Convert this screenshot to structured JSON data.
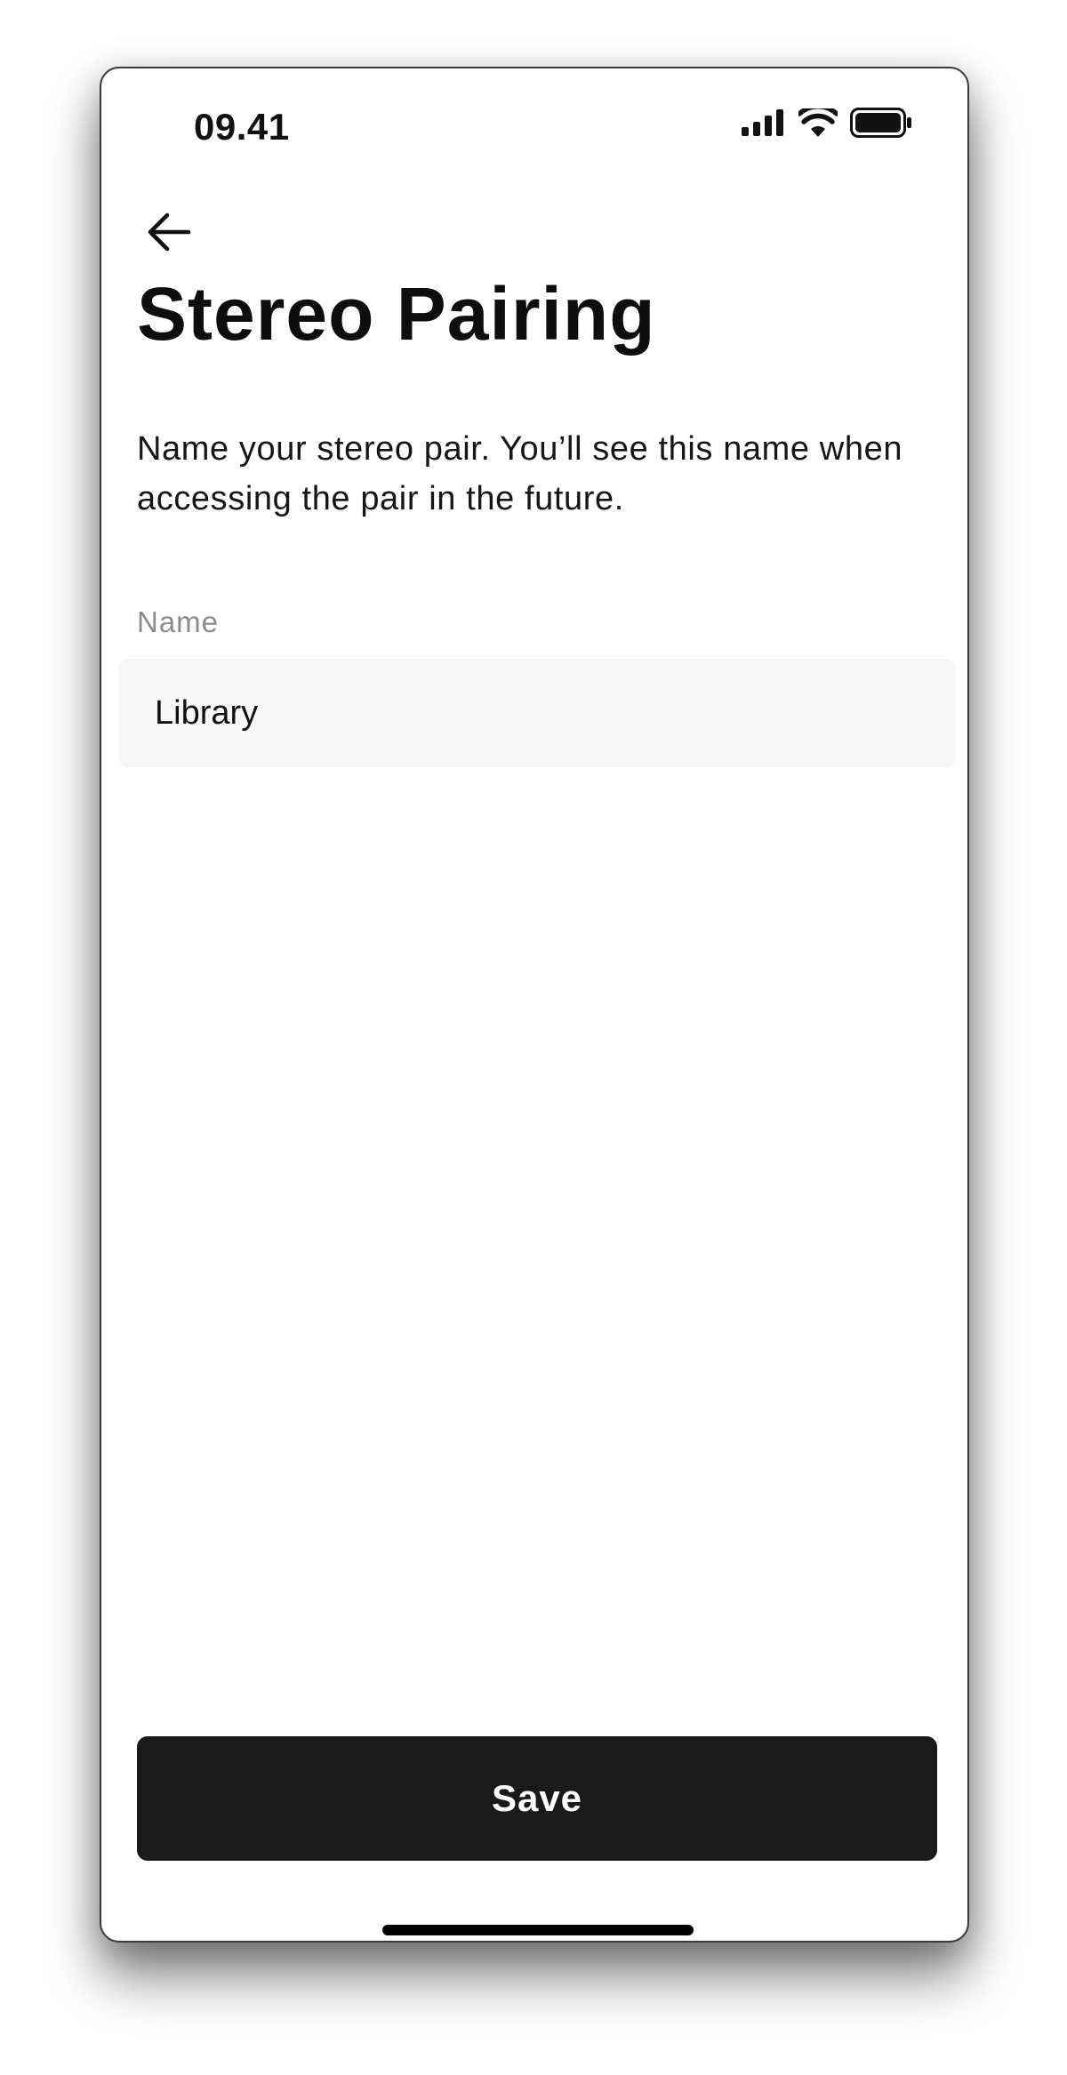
{
  "status_bar": {
    "time": "09.41",
    "icons": [
      "cellular-signal-icon",
      "wifi-icon",
      "battery-icon"
    ]
  },
  "header": {
    "back_icon": "arrow-left-icon",
    "title": "Stereo Pairing"
  },
  "content": {
    "description": "Name your stereo pair. You’ll see this name when accessing the pair in the future.",
    "name_field": {
      "label": "Name",
      "value": "Library"
    }
  },
  "footer": {
    "save_label": "Save"
  },
  "colors": {
    "button_background": "#1b1a1b",
    "input_background": "#f7f7f7",
    "label_gray": "#8c8c8c"
  }
}
